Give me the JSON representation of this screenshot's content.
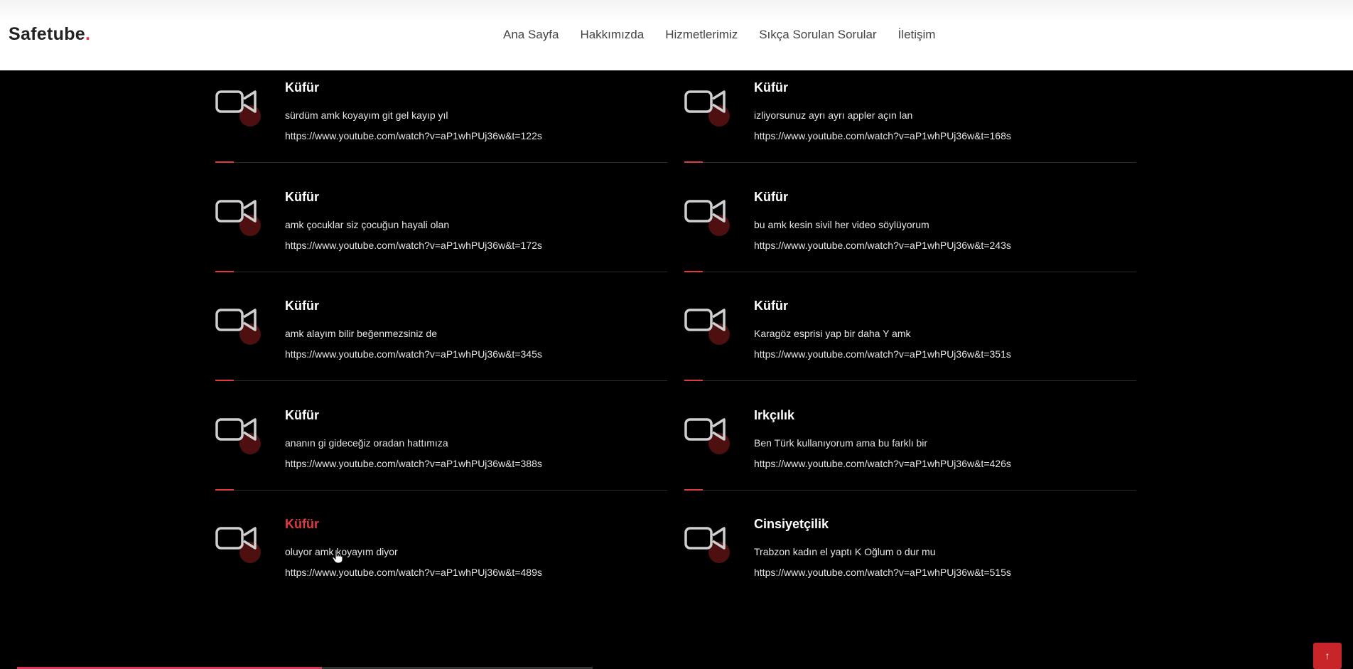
{
  "header": {
    "logo": "Safetube",
    "logo_dot": ".",
    "nav": [
      "Ana Sayfa",
      "Hakkımızda",
      "Hizmetlerimiz",
      "Sıkça Sorulan Sorular",
      "İletişim"
    ]
  },
  "items": [
    {
      "title": "Küfür",
      "desc": "sürdüm amk koyayım git gel kayıp yıl",
      "link": "https://www.youtube.com/watch?v=aP1whPUj36w&t=122s"
    },
    {
      "title": "Küfür",
      "desc": "izliyorsunuz ayrı ayrı appler açın lan",
      "link": "https://www.youtube.com/watch?v=aP1whPUj36w&t=168s"
    },
    {
      "title": "Küfür",
      "desc": "amk çocuklar siz çocuğun hayali olan",
      "link": "https://www.youtube.com/watch?v=aP1whPUj36w&t=172s"
    },
    {
      "title": "Küfür",
      "desc": "bu amk kesin sivil her video söylüyorum",
      "link": "https://www.youtube.com/watch?v=aP1whPUj36w&t=243s"
    },
    {
      "title": "Küfür",
      "desc": "amk alayım bilir beğenmezsiniz de",
      "link": "https://www.youtube.com/watch?v=aP1whPUj36w&t=345s"
    },
    {
      "title": "Küfür",
      "desc": "Karagöz esprisi yap bir daha Y amk",
      "link": "https://www.youtube.com/watch?v=aP1whPUj36w&t=351s"
    },
    {
      "title": "Küfür",
      "desc": "ananın gi gideceğiz oradan hattımıza",
      "link": "https://www.youtube.com/watch?v=aP1whPUj36w&t=388s"
    },
    {
      "title": "Irkçılık",
      "desc": "Ben Türk kullanıyorum ama bu farklı bir",
      "link": "https://www.youtube.com/watch?v=aP1whPUj36w&t=426s"
    },
    {
      "title": "Küfür",
      "desc": "oluyor amk koyayım diyor",
      "link": "https://www.youtube.com/watch?v=aP1whPUj36w&t=489s"
    },
    {
      "title": "Cinsiyetçilik",
      "desc": "Trabzon kadın el yaptı K Oğlum o dur mu",
      "link": "https://www.youtube.com/watch?v=aP1whPUj36w&t=515s"
    }
  ],
  "back_to_top": "↑",
  "scroll_progress": 0.53,
  "colors": {
    "accent": "#e03a3e",
    "background": "#000000"
  }
}
